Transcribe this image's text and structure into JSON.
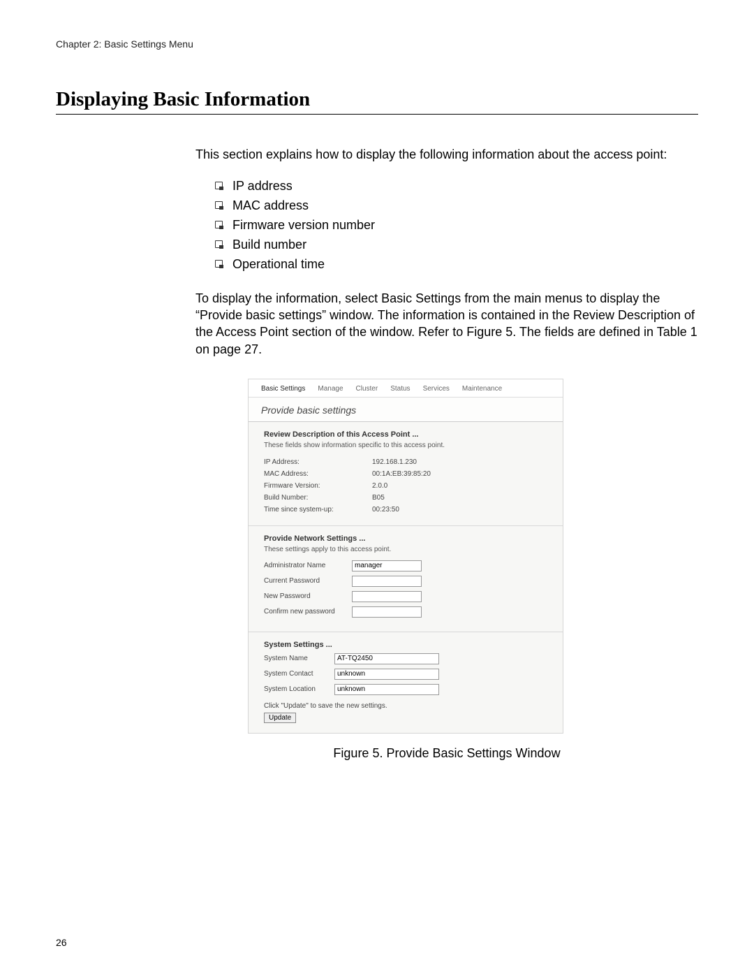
{
  "header": "Chapter 2: Basic Settings Menu",
  "title": "Displaying Basic Information",
  "intro": "This section explains how to display the following information about the access point:",
  "bullets": [
    "IP address",
    "MAC address",
    "Firmware version number",
    "Build number",
    "Operational time"
  ],
  "para2": "To display the information, select Basic Settings from the main menus to display the “Provide basic settings” window. The information is contained in the Review Description of the Access Point section of the window. Refer to Figure 5. The fields are defined in Table 1 on page 27.",
  "ui": {
    "tabs": [
      "Basic Settings",
      "Manage",
      "Cluster",
      "Status",
      "Services",
      "Maintenance"
    ],
    "subheader": "Provide basic settings",
    "review": {
      "title": "Review Description of this Access Point ...",
      "desc": "These fields show information specific to this access point.",
      "rows": {
        "ip_label": "IP Address:",
        "ip_value": "192.168.1.230",
        "mac_label": "MAC Address:",
        "mac_value": "00:1A:EB:39:85:20",
        "fw_label": "Firmware Version:",
        "fw_value": "2.0.0",
        "build_label": "Build Number:",
        "build_value": "B05",
        "uptime_label": "Time since system-up:",
        "uptime_value": "00:23:50"
      }
    },
    "network": {
      "title": "Provide Network Settings ...",
      "desc": "These settings apply to this access point.",
      "admin_label": "Administrator Name",
      "admin_value": "manager",
      "curpw_label": "Current Password",
      "newpw_label": "New Password",
      "confpw_label": "Confirm new password"
    },
    "system": {
      "title": "System Settings ...",
      "name_label": "System Name",
      "name_value": "AT-TQ2450",
      "contact_label": "System Contact",
      "contact_value": "unknown",
      "location_label": "System Location",
      "location_value": "unknown",
      "hint": "Click \"Update\" to save the new settings.",
      "button": "Update"
    }
  },
  "figure_caption": "Figure 5. Provide Basic Settings Window",
  "page_number": "26"
}
